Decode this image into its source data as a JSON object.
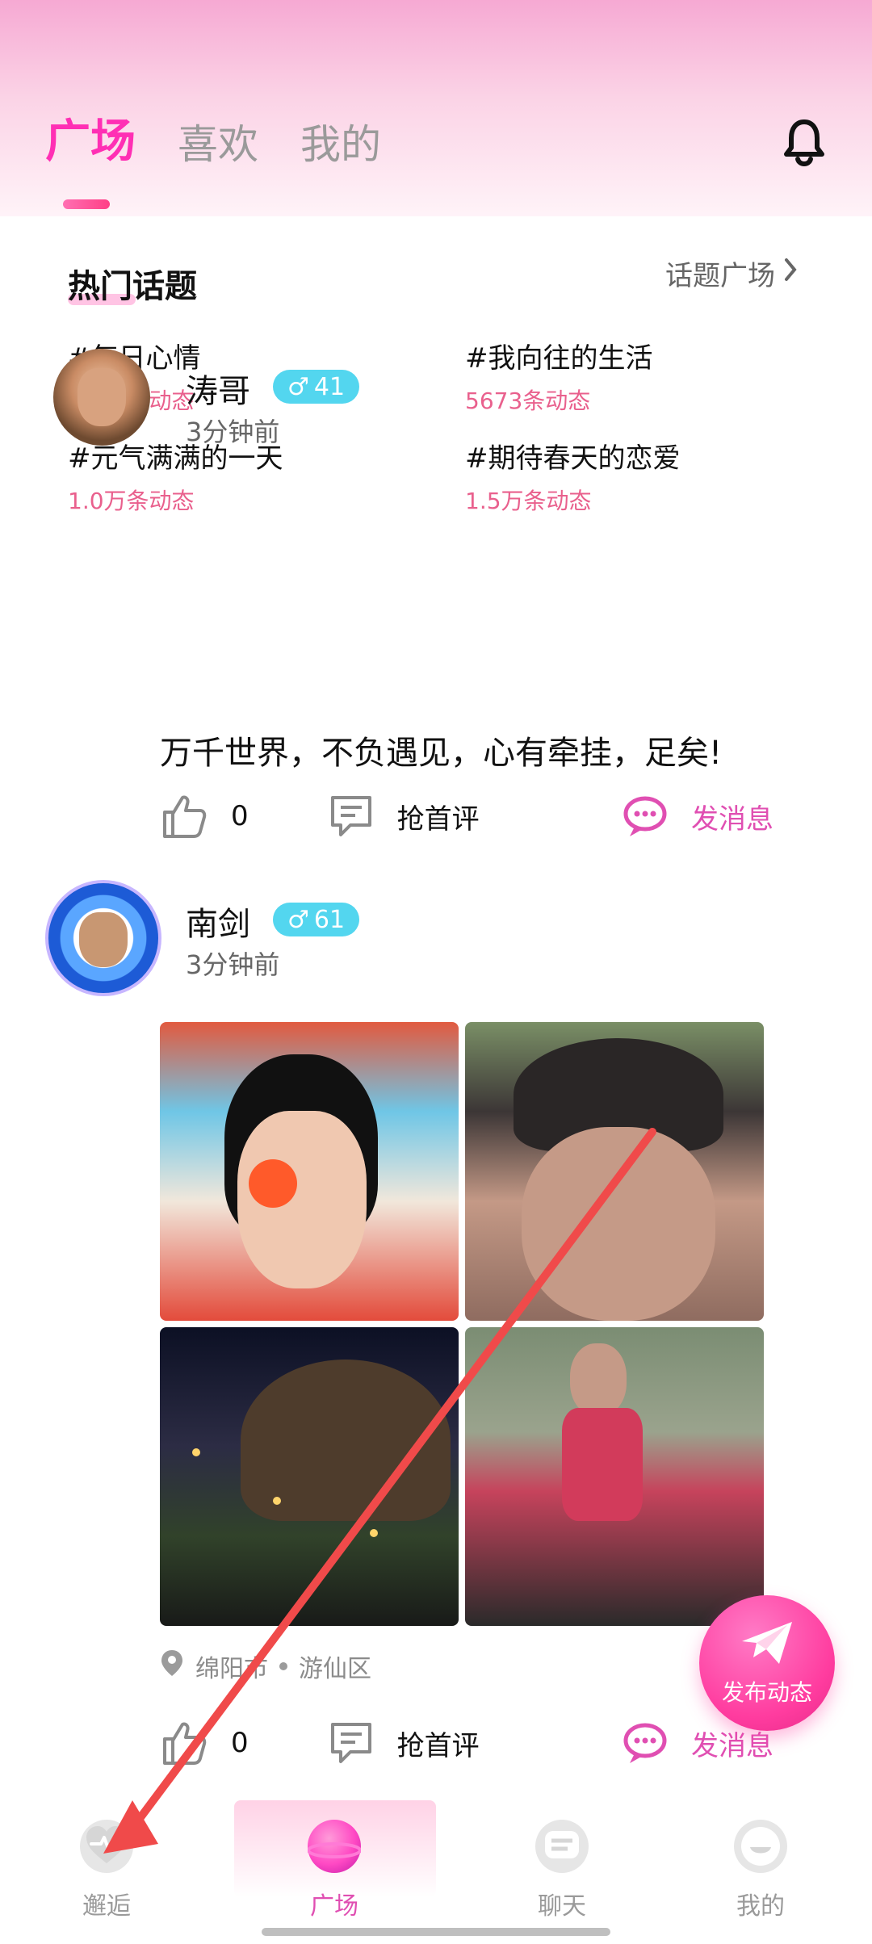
{
  "header": {
    "tabs": [
      {
        "label": "广场",
        "active": true
      },
      {
        "label": "喜欢",
        "active": false
      },
      {
        "label": "我的",
        "active": false
      }
    ]
  },
  "topics": {
    "title": "热门话题",
    "link": "话题广场",
    "items": [
      {
        "name": "#每日心情",
        "count": "1.2万条动态"
      },
      {
        "name": "#我向往的生活",
        "count": "5673条动态"
      },
      {
        "name": "#元气满满的一天",
        "count": "1.0万条动态"
      },
      {
        "name": "#期待春天的恋爱",
        "count": "1.5万条动态"
      }
    ]
  },
  "posts": [
    {
      "username": "涛哥",
      "gender_icon": "♂",
      "age": "41",
      "time": "3分钟前",
      "content": "万千世界，不负遇见，心有牵挂，足矣!",
      "likes": "0",
      "comment_label": "抢首评",
      "message_label": "发消息"
    },
    {
      "username": "南剑",
      "gender_icon": "♂",
      "age": "61",
      "time": "3分钟前",
      "location_city": "绵阳市",
      "location_district": "游仙区",
      "likes": "0",
      "comment_label": "抢首评",
      "message_label": "发消息"
    }
  ],
  "fab": {
    "label": "发布动态"
  },
  "bottom_nav": [
    {
      "label": "邂逅",
      "active": false
    },
    {
      "label": "广场",
      "active": true
    },
    {
      "label": "聊天",
      "active": false
    },
    {
      "label": "我的",
      "active": false
    }
  ],
  "colors": {
    "accent": "#ff2fb4",
    "badge": "#53d6ef",
    "count": "#e9608d",
    "arrow": "#f04a4a"
  }
}
